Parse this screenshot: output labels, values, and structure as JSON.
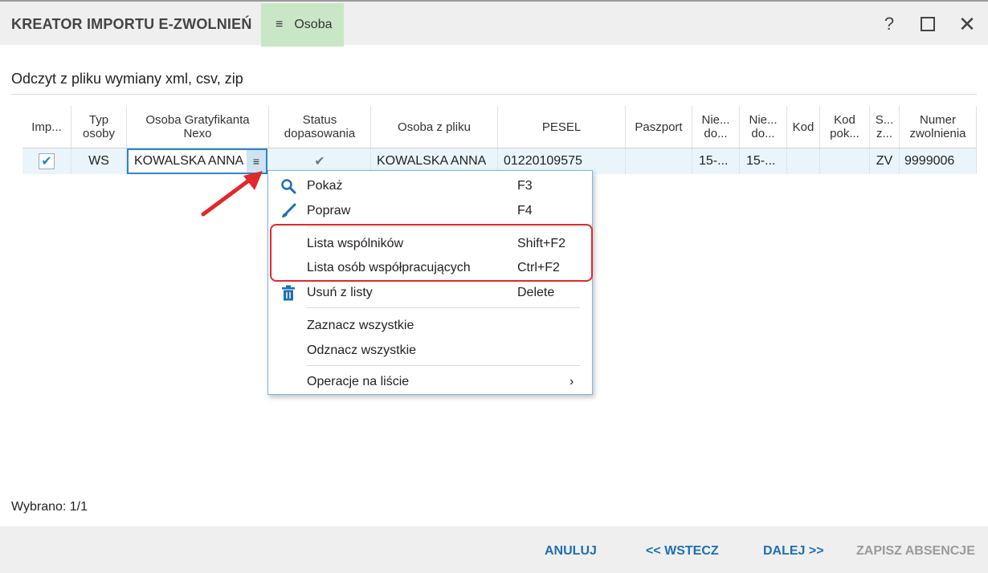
{
  "window": {
    "title": "KREATOR IMPORTU E-ZWOLNIEŃ",
    "tab_label": "Osoba",
    "help_label": "?",
    "close_label": "✕"
  },
  "subtitle": "Odczyt z pliku wymiany xml, csv, zip",
  "table": {
    "headers": [
      "Imp...",
      "Typ\nosoby",
      "Osoba Gratyfikanta\nNexo",
      "Status\ndopasowania",
      "Osoba z pliku",
      "PESEL",
      "Paszport",
      "Nie...\ndo...",
      "Nie...\ndo...",
      "Kod",
      "Kod\npok...",
      "S...\nz...",
      "Numer\nzwolnienia"
    ],
    "rows": [
      {
        "import_checked": true,
        "typ": "WS",
        "osoba_nexo": "KOWALSKA ANNA",
        "status_icon": "check-icon",
        "osoba_plik": "KOWALSKA ANNA",
        "pesel": "01220109575",
        "paszport": "",
        "nie1": "15-...",
        "nie2": "15-...",
        "kod": "",
        "kod_pok": "",
        "s": "ZV",
        "numer": "9999006"
      }
    ]
  },
  "context_menu": {
    "items": [
      {
        "label": "Pokaż",
        "shortcut": "F3",
        "icon": "search-icon"
      },
      {
        "label": "Popraw",
        "shortcut": "F4",
        "icon": "brush-icon"
      },
      {
        "label": "Lista wspólników",
        "shortcut": "Shift+F2"
      },
      {
        "label": "Lista osób współpracujących",
        "shortcut": "Ctrl+F2"
      },
      {
        "label": "Usuń z listy",
        "shortcut": "Delete",
        "icon": "trash-icon"
      },
      {
        "label": "Zaznacz wszystkie",
        "shortcut": ""
      },
      {
        "label": "Odznacz wszystkie",
        "shortcut": ""
      },
      {
        "label": "Operacje na liście",
        "shortcut": "›"
      }
    ]
  },
  "status": "Wybrano: 1/1",
  "footer": {
    "cancel": "ANULUJ",
    "back": "<< WSTECZ",
    "next": "DALEJ >>",
    "save": "ZAPISZ ABSENCJE"
  },
  "colors": {
    "accent": "#1e6fb2",
    "tab_bg": "#c9e7c7",
    "row_bg": "#eaf5fb",
    "highlight": "#e0292b"
  }
}
